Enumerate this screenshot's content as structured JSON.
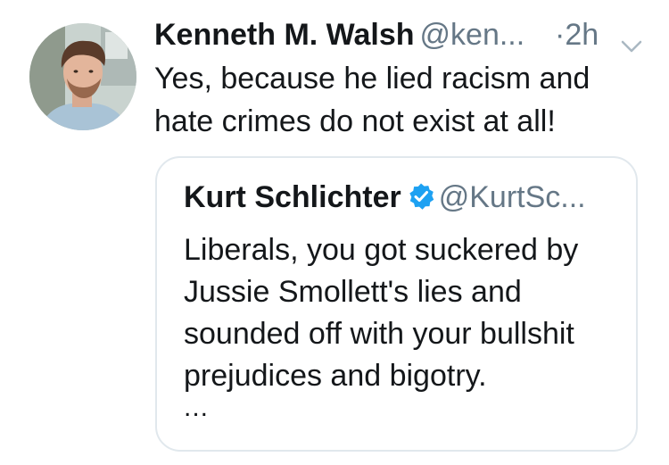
{
  "tweet": {
    "author": {
      "display_name": "Kenneth M. Walsh",
      "handle": "@ken...",
      "avatar_icon": "user-avatar-photo"
    },
    "time": "·2h",
    "menu_icon": "chevron-down-icon",
    "text": "Yes, because he lied racism and\nhate crimes do not exist at all!",
    "quoted_tweet": {
      "display_name": "Kurt Schlichter",
      "verified_icon": "verified-badge-icon",
      "handle": "@KurtSc...",
      "text": "Liberals, you got suckered by\nJussie Smollett's lies and\nsounded off with your bullshit\nprejudices and bigotry.",
      "truncation": "..."
    }
  },
  "colors": {
    "text_primary": "#14171a",
    "text_secondary": "#657786",
    "border": "#e1e8ed",
    "verified_blue": "#1da1f2"
  }
}
